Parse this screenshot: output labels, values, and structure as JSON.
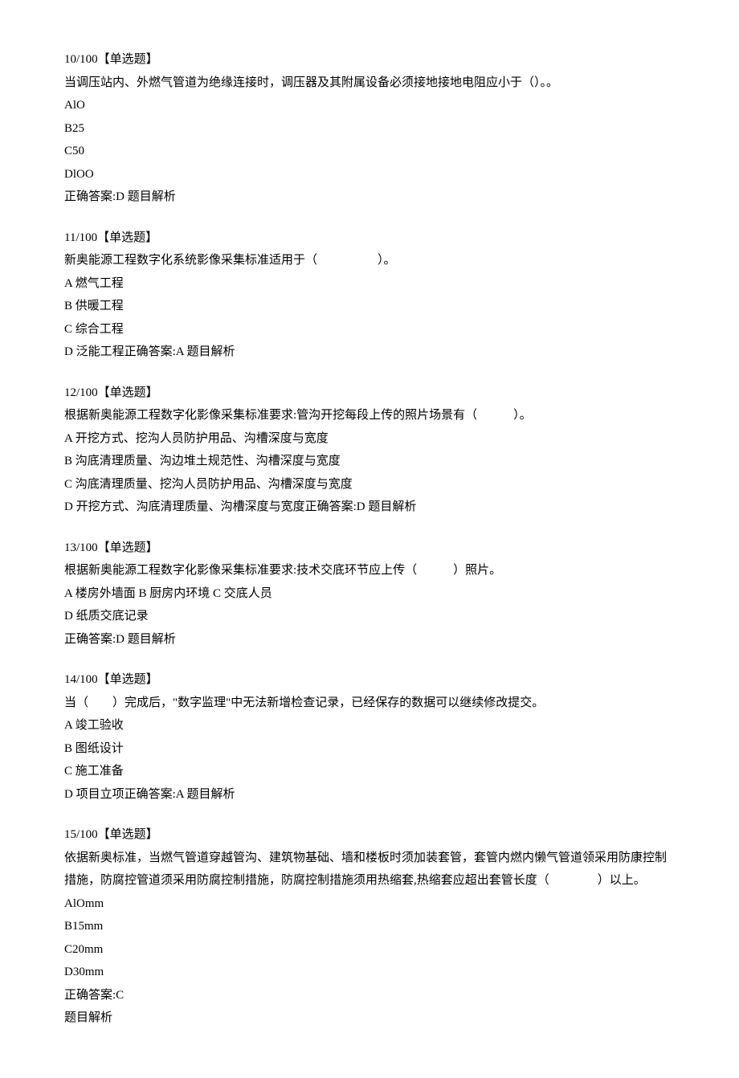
{
  "questions": [
    {
      "number": "10/100【单选题】",
      "stem": "当调压站内、外燃气管道为绝缘连接时，调压器及其附属设备必须接地接地电阻应小于（）。。",
      "options": [
        "AlO",
        "B25",
        "C50",
        "DlOO"
      ],
      "answer": "正确答案:D 题目解析"
    },
    {
      "number": "11/100【单选题】",
      "stem": "新奥能源工程数字化系统影像采集标准适用于（　　　　　）。",
      "options": [
        "A 燃气工程",
        "B 供暖工程",
        "C 综合工程"
      ],
      "trailing": "D 泛能工程正确答案:A 题目解析"
    },
    {
      "number": "12/100【单选题】",
      "stem": "根据新奥能源工程数字化影像采集标准要求:管沟开挖每段上传的照片场景有（　　　）。",
      "options": [
        "A 开挖方式、挖沟人员防护用品、沟槽深度与宽度",
        "B 沟底清理质量、沟边堆土规范性、沟槽深度与宽度",
        "C 沟底清理质量、挖沟人员防护用品、沟槽深度与宽度"
      ],
      "trailing": "D 开挖方式、沟底清理质量、沟槽深度与宽度正确答案:D 题目解析"
    },
    {
      "number": "13/100【单选题】",
      "stem": "根据新奥能源工程数字化影像采集标准要求:技术交底环节应上传（　　　）照片。",
      "options": [
        "A 楼房外墙面 B 厨房内环境 C 交底人员",
        "D 纸质交底记录"
      ],
      "answer": "正确答案:D 题目解析"
    },
    {
      "number": "14/100【单选题】",
      "stem": "当（　　）完成后，\"数字监理\"中无法新增检查记录，已经保存的数据可以继续修改提交。",
      "options": [
        "A 竣工验收",
        "B 图纸设计",
        "C 施工准备"
      ],
      "trailing": "D 项目立项正确答案:A 题目解析"
    },
    {
      "number": "15/100【单选题】",
      "stem": "依据新奥标准，当燃气管道穿越管沟、建筑物基础、墙和楼板时须加装套管，套管内燃内懒气管道领采用防康控制措施，防腐控管道须采用防腐控制措施，防腐控制措施须用热缩套,热缩套应超出套管长度（　　　　）以上。",
      "options": [
        "AlOmm",
        "B15mm",
        "C20mm",
        "D30mm"
      ],
      "answer": "正确答案:C",
      "answer2": "题目解析"
    }
  ]
}
